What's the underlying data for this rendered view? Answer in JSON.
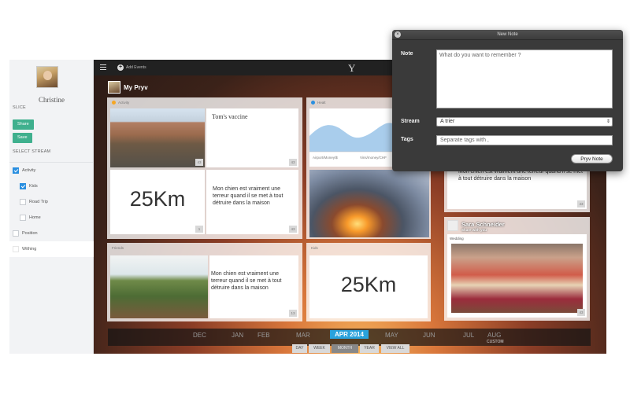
{
  "sidebar": {
    "user_name": "Christine",
    "slice_label": "SLICE",
    "share_label": "Share",
    "save_label": "Save",
    "select_stream_label": "SELECT STREAM",
    "streams": [
      {
        "label": "Activity",
        "checked": true
      },
      {
        "label": "Kids",
        "checked": true
      },
      {
        "label": "Road Trip",
        "checked": false
      },
      {
        "label": "Home",
        "checked": false
      },
      {
        "label": "Position",
        "checked": false
      },
      {
        "label": "Withing",
        "checked": false
      }
    ]
  },
  "topbar": {
    "add_events_label": "Add Events",
    "logo": "Y"
  },
  "header": {
    "title": "My Pryv"
  },
  "panels": {
    "activity": {
      "title": "Activity",
      "note_title": "Tom's vaccine",
      "big_value": "25Km",
      "body_text": "Mon chien est vraiment une terreur quand il se met à tout détruire dans la maison",
      "count_photo": "43",
      "count_value": "1",
      "count_text": "43"
    },
    "health": {
      "title": "Healt",
      "chart_caption_left": "Airport/Money/$",
      "chart_caption_right": "Vins/money/CHF",
      "count": "43"
    },
    "friends": {
      "title": "Friends",
      "body_text": "Mon chien est vraiment une terreur quand il se met à tout détruire dans la maison",
      "count": "13"
    },
    "kids": {
      "title": "Kids",
      "big_value": "25Km"
    },
    "right_top": {
      "body_text": "Mon chien est vraiment une terreur quand il se met à tout détruire dans la maison",
      "count": "43"
    },
    "sara": {
      "name": "Sara Schneider",
      "subtitle": "Share with you",
      "caption": "Wedding",
      "count": "43"
    }
  },
  "timeline": {
    "months": [
      "DEC",
      "JAN",
      "FEB",
      "MAR",
      "APR 2014",
      "MAY",
      "JUN",
      "JUL",
      "AUG"
    ],
    "active_month": "APR 2014",
    "custom_label": "CUSTOM",
    "ranges": [
      "DAY",
      "WEEK",
      "MONTH",
      "YEAR",
      "VIEW ALL"
    ],
    "active_range": "MONTH"
  },
  "dialog": {
    "title": "New Note",
    "note_label": "Note",
    "note_placeholder": "What do you want to remember ?",
    "stream_label": "Stream",
    "stream_value": "A trier",
    "tags_label": "Tags",
    "tags_placeholder": "Separate tags with ,",
    "submit_label": "Pryv Note"
  },
  "colors": {
    "accent_green": "#3fb08e",
    "accent_blue": "#2aa2dd",
    "activity_dot": "#f5a623",
    "health_dot": "#2a8fe0"
  },
  "icons": [
    "menu-icon",
    "plus-icon",
    "close-icon",
    "checkbox-icon",
    "chevron-updown-icon"
  ]
}
